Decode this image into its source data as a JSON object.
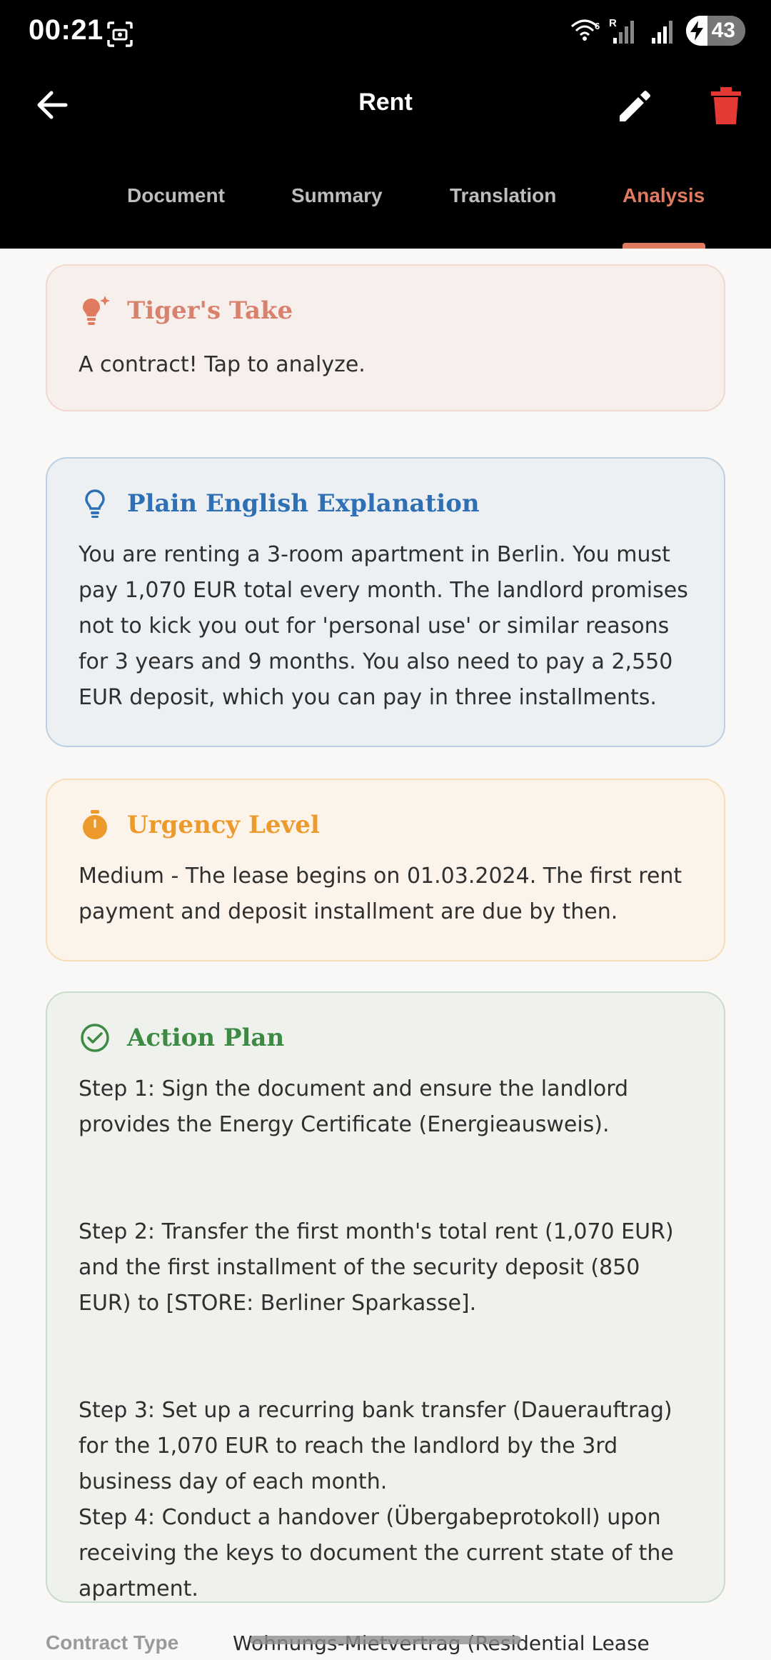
{
  "status_bar": {
    "time": "00:21",
    "network_label": "R",
    "wifi_badge": "6",
    "battery_level": "43"
  },
  "app_bar": {
    "title": "Rent"
  },
  "tabs": [
    {
      "label": "Document",
      "active": false
    },
    {
      "label": "Summary",
      "active": false
    },
    {
      "label": "Translation",
      "active": false
    },
    {
      "label": "Analysis",
      "active": true
    }
  ],
  "cards": {
    "tigers_take": {
      "title": "Tiger's Take",
      "body": "A contract! Tap to analyze.",
      "icon": "lightbulb-sparkle-icon",
      "accent": "#d8826d"
    },
    "plain_english": {
      "title": "Plain English Explanation",
      "body": "You are renting a 3-room apartment in Berlin. You must pay 1,070 EUR total every month. The landlord promises not to kick you out for 'personal use' or similar reasons for 3 years and 9 months. You also need to pay a 2,550 EUR deposit, which you can pay in three installments.",
      "icon": "lightbulb-outline-icon",
      "accent": "#2f6fb3"
    },
    "urgency": {
      "title": "Urgency Level",
      "body": "Medium - The lease begins on 01.03.2024. The first rent payment and deposit installment are due by then.",
      "icon": "timer-icon",
      "accent": "#eb9a2b"
    },
    "action_plan": {
      "title": "Action Plan",
      "steps": [
        "Step 1: Sign the document and ensure the landlord provides the Energy Certificate (Energieausweis).",
        "Step 2: Transfer the first month's total rent (1,070 EUR) and the first installment of the security deposit (850 EUR) to [STORE: Berliner Sparkasse].",
        "Step 3: Set up a recurring bank transfer (Dauerauftrag) for the 1,070 EUR to reach the landlord by the 3rd business day of each month.",
        "Step 4: Conduct a handover (Übergabeprotokoll) upon receiving the keys to document the current state of the apartment."
      ],
      "icon": "check-circle-icon",
      "accent": "#3c8a43"
    }
  },
  "details": {
    "contract_type_label": "Contract Type",
    "contract_type_value": "Wohnungs-Mietvertrag (Residential Lease"
  }
}
